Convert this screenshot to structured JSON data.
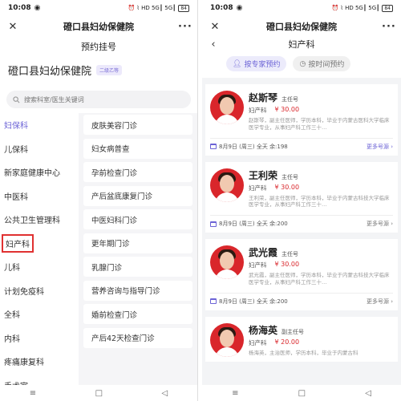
{
  "status_bar": {
    "time": "10:08",
    "right_icons": "⏰ ⌇ HD 5G┃ 5G┃",
    "battery": "84"
  },
  "left": {
    "close_icon": "✕",
    "title": "磴口县妇幼保健院",
    "more_icon": "···",
    "subtitle": "预约挂号",
    "hospital_name": "磴口县妇幼保健院",
    "hospital_grade": "二级乙等",
    "search_placeholder": "搜索科室/医生关键词",
    "departments": [
      "妇保科",
      "儿保科",
      "新家庭健康中心",
      "中医科",
      "公共卫生管理科",
      "妇产科",
      "儿科",
      "计划免疫科",
      "全科",
      "内科",
      "疼痛康复科",
      "手术室"
    ],
    "clinics": [
      "皮肤美容门诊",
      "妇女病普查",
      "孕前检查门诊",
      "产后盆底康复门诊",
      "中医妇科门诊",
      "更年期门诊",
      "乳腺门诊",
      "营养咨询与指导门诊",
      "婚前检查门诊",
      "产后42天检查门诊"
    ]
  },
  "right": {
    "close_icon": "✕",
    "title": "磴口县妇幼保健院",
    "more_icon": "···",
    "back_icon": "‹",
    "dept_title": "妇产科",
    "tab_expert": "按专家预约",
    "tab_time": "按时间预约",
    "doctors": [
      {
        "name": "赵斯琴",
        "rank": "主任号",
        "dept": "妇产科",
        "price": "¥ 30.00",
        "bio": "赵斯琴，副主任医师，学历本科，毕业于内蒙古医科大学临床医学专业，从事妇产科工作三十…",
        "schedule": "8月9日 (周三) 全天 余:198",
        "more": "更多号源 ›",
        "more_active": true
      },
      {
        "name": "王利荣",
        "rank": "主任号",
        "dept": "妇产科",
        "price": "¥ 30.00",
        "bio": "王利荣，副主任医师，学历本科，毕业于内蒙古科技大学临床医学专业，从事妇产科工作三十…",
        "schedule": "8月9日 (周三) 全天 余:200",
        "more": "更多号源 ›",
        "more_active": false
      },
      {
        "name": "武光霞",
        "rank": "主任号",
        "dept": "妇产科",
        "price": "¥ 30.00",
        "bio": "武光霞，副主任医师，学历本科，毕业于内蒙古科技大学临床医学专业，从事妇产科工作三十…",
        "schedule": "8月9日 (周三) 全天 余:200",
        "more": "更多号源 ›",
        "more_active": false
      },
      {
        "name": "杨海英",
        "rank": "副主任号",
        "dept": "妇产科",
        "price": "¥ 20.00",
        "bio": "杨海英，主治医师，学历本科，毕业于内蒙古科",
        "schedule": "",
        "more": "",
        "more_active": false
      }
    ]
  },
  "nav": {
    "menu": "≡",
    "home": "□",
    "back": "◁"
  },
  "colors": {
    "accent": "#6c63d6",
    "price": "#d9262b",
    "highlight_border": "#e03131"
  }
}
